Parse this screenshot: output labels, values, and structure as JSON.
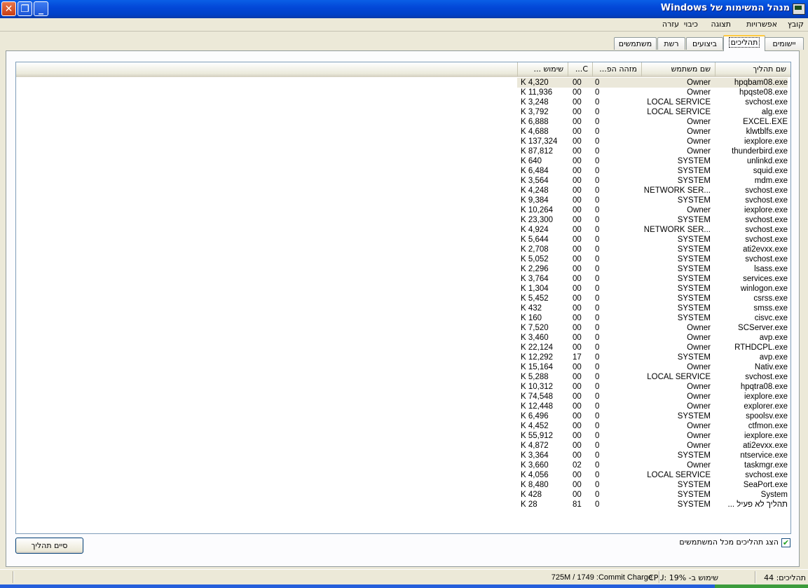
{
  "window": {
    "title": "מנהל המשימות של Windows",
    "close": "✕",
    "restore": "❐",
    "minimize": "_"
  },
  "menu": [
    "קובץ",
    "אפשרויות",
    "תצוגה",
    "כיבוי",
    "עזרה"
  ],
  "tabs": [
    {
      "label": "יישומים",
      "active": false
    },
    {
      "label": "תהליכים",
      "active": true
    },
    {
      "label": "ביצועים",
      "active": false
    },
    {
      "label": "רשת",
      "active": false
    },
    {
      "label": "משתמשים",
      "active": false
    }
  ],
  "columns": {
    "name": "שם תהליך",
    "user": "שם משתמש",
    "pid": "מזהה הפ...",
    "cpu": "C...",
    "mem": "שימוש ..."
  },
  "processes": [
    {
      "name": "hpqbam08.exe",
      "user": "Owner",
      "pid": "0",
      "cpu": "00",
      "mem": "4,320 K"
    },
    {
      "name": "hpqste08.exe",
      "user": "Owner",
      "pid": "0",
      "cpu": "00",
      "mem": "11,936 K"
    },
    {
      "name": "svchost.exe",
      "user": "LOCAL SERVICE",
      "pid": "0",
      "cpu": "00",
      "mem": "3,248 K"
    },
    {
      "name": "alg.exe",
      "user": "LOCAL SERVICE",
      "pid": "0",
      "cpu": "00",
      "mem": "3,792 K"
    },
    {
      "name": "EXCEL.EXE",
      "user": "Owner",
      "pid": "0",
      "cpu": "00",
      "mem": "6,888 K"
    },
    {
      "name": "klwtblfs.exe",
      "user": "Owner",
      "pid": "0",
      "cpu": "00",
      "mem": "4,688 K"
    },
    {
      "name": "iexplore.exe",
      "user": "Owner",
      "pid": "0",
      "cpu": "00",
      "mem": "137,324 K"
    },
    {
      "name": "thunderbird.exe",
      "user": "Owner",
      "pid": "0",
      "cpu": "00",
      "mem": "87,812 K"
    },
    {
      "name": "unlinkd.exe",
      "user": "SYSTEM",
      "pid": "0",
      "cpu": "00",
      "mem": "640 K"
    },
    {
      "name": "squid.exe",
      "user": "SYSTEM",
      "pid": "0",
      "cpu": "00",
      "mem": "6,484 K"
    },
    {
      "name": "mdm.exe",
      "user": "SYSTEM",
      "pid": "0",
      "cpu": "00",
      "mem": "3,564 K"
    },
    {
      "name": "svchost.exe",
      "user": "NETWORK SER...",
      "pid": "0",
      "cpu": "00",
      "mem": "4,248 K"
    },
    {
      "name": "svchost.exe",
      "user": "SYSTEM",
      "pid": "0",
      "cpu": "00",
      "mem": "9,384 K"
    },
    {
      "name": "iexplore.exe",
      "user": "Owner",
      "pid": "0",
      "cpu": "00",
      "mem": "10,264 K"
    },
    {
      "name": "svchost.exe",
      "user": "SYSTEM",
      "pid": "0",
      "cpu": "00",
      "mem": "23,300 K"
    },
    {
      "name": "svchost.exe",
      "user": "NETWORK SER...",
      "pid": "0",
      "cpu": "00",
      "mem": "4,924 K"
    },
    {
      "name": "svchost.exe",
      "user": "SYSTEM",
      "pid": "0",
      "cpu": "00",
      "mem": "5,644 K"
    },
    {
      "name": "ati2evxx.exe",
      "user": "SYSTEM",
      "pid": "0",
      "cpu": "00",
      "mem": "2,708 K"
    },
    {
      "name": "svchost.exe",
      "user": "SYSTEM",
      "pid": "0",
      "cpu": "00",
      "mem": "5,052 K"
    },
    {
      "name": "lsass.exe",
      "user": "SYSTEM",
      "pid": "0",
      "cpu": "00",
      "mem": "2,296 K"
    },
    {
      "name": "services.exe",
      "user": "SYSTEM",
      "pid": "0",
      "cpu": "00",
      "mem": "3,764 K"
    },
    {
      "name": "winlogon.exe",
      "user": "SYSTEM",
      "pid": "0",
      "cpu": "00",
      "mem": "1,304 K"
    },
    {
      "name": "csrss.exe",
      "user": "SYSTEM",
      "pid": "0",
      "cpu": "00",
      "mem": "5,452 K"
    },
    {
      "name": "smss.exe",
      "user": "SYSTEM",
      "pid": "0",
      "cpu": "00",
      "mem": "432 K"
    },
    {
      "name": "cisvc.exe",
      "user": "SYSTEM",
      "pid": "0",
      "cpu": "00",
      "mem": "160 K"
    },
    {
      "name": "SCServer.exe",
      "user": "Owner",
      "pid": "0",
      "cpu": "00",
      "mem": "7,520 K"
    },
    {
      "name": "avp.exe",
      "user": "Owner",
      "pid": "0",
      "cpu": "00",
      "mem": "3,460 K"
    },
    {
      "name": "RTHDCPL.exe",
      "user": "Owner",
      "pid": "0",
      "cpu": "00",
      "mem": "22,124 K"
    },
    {
      "name": "avp.exe",
      "user": "SYSTEM",
      "pid": "0",
      "cpu": "17",
      "mem": "12,292 K"
    },
    {
      "name": "Nativ.exe",
      "user": "Owner",
      "pid": "0",
      "cpu": "00",
      "mem": "15,164 K"
    },
    {
      "name": "svchost.exe",
      "user": "LOCAL SERVICE",
      "pid": "0",
      "cpu": "00",
      "mem": "5,288 K"
    },
    {
      "name": "hpqtra08.exe",
      "user": "Owner",
      "pid": "0",
      "cpu": "00",
      "mem": "10,312 K"
    },
    {
      "name": "iexplore.exe",
      "user": "Owner",
      "pid": "0",
      "cpu": "00",
      "mem": "74,548 K"
    },
    {
      "name": "explorer.exe",
      "user": "Owner",
      "pid": "0",
      "cpu": "00",
      "mem": "12,448 K"
    },
    {
      "name": "spoolsv.exe",
      "user": "SYSTEM",
      "pid": "0",
      "cpu": "00",
      "mem": "6,496 K"
    },
    {
      "name": "ctfmon.exe",
      "user": "Owner",
      "pid": "0",
      "cpu": "00",
      "mem": "4,452 K"
    },
    {
      "name": "iexplore.exe",
      "user": "Owner",
      "pid": "0",
      "cpu": "00",
      "mem": "55,912 K"
    },
    {
      "name": "ati2evxx.exe",
      "user": "Owner",
      "pid": "0",
      "cpu": "00",
      "mem": "4,872 K"
    },
    {
      "name": "ntservice.exe",
      "user": "SYSTEM",
      "pid": "0",
      "cpu": "00",
      "mem": "3,364 K"
    },
    {
      "name": "taskmgr.exe",
      "user": "Owner",
      "pid": "0",
      "cpu": "02",
      "mem": "3,660 K"
    },
    {
      "name": "svchost.exe",
      "user": "LOCAL SERVICE",
      "pid": "0",
      "cpu": "00",
      "mem": "4,056 K"
    },
    {
      "name": "SeaPort.exe",
      "user": "SYSTEM",
      "pid": "0",
      "cpu": "00",
      "mem": "8,480 K"
    },
    {
      "name": "System",
      "user": "SYSTEM",
      "pid": "0",
      "cpu": "00",
      "mem": "428 K"
    },
    {
      "name": "תהליך לא פעיל ...",
      "user": "SYSTEM",
      "pid": "0",
      "cpu": "81",
      "mem": "28 K"
    }
  ],
  "show_all_users": {
    "label": "הצג תהליכים מכל המשתמשים",
    "checked": true,
    "check_glyph": "✔"
  },
  "end_process_label": "סיים תהליך",
  "status": {
    "processes": "תהליכים: 44",
    "cpu": "שימוש ב- CPU: 19%",
    "commit": "725M / 1749 :Commit Charge"
  }
}
